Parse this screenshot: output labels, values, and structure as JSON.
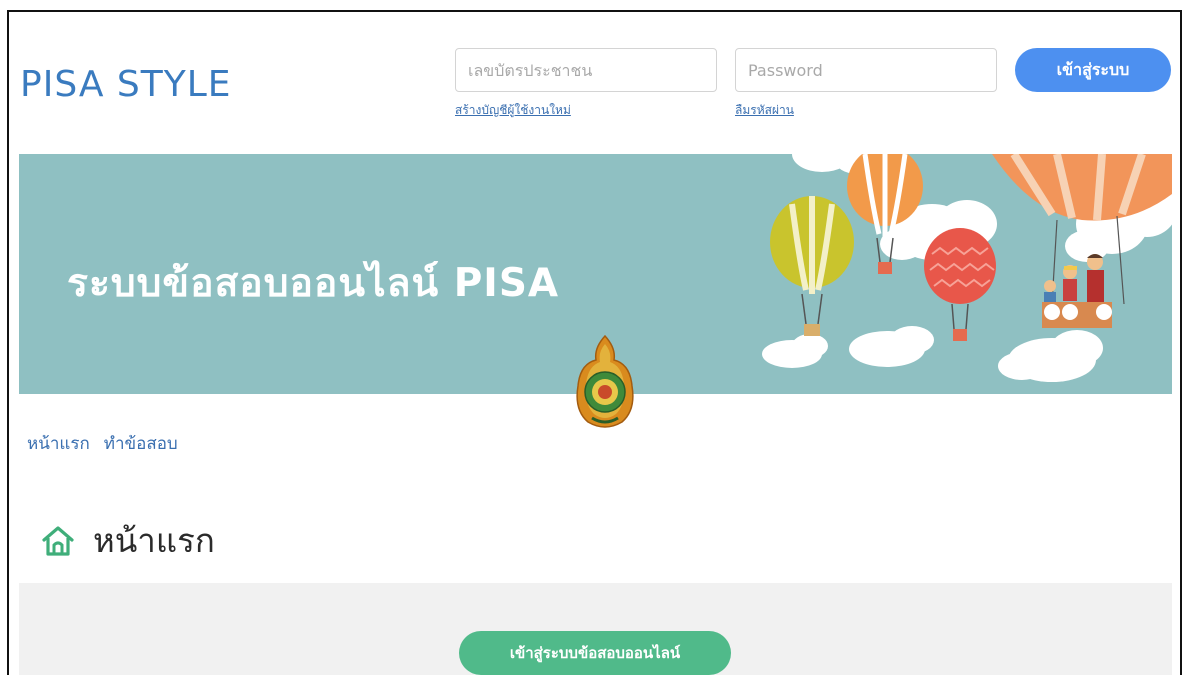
{
  "header": {
    "brand": "PISA STYLE",
    "id_field": {
      "placeholder": "เลขบัตรประชาชน",
      "value": ""
    },
    "password_field": {
      "placeholder": "Password",
      "value": ""
    },
    "register_link": "สร้างบัญชีผู้ใช้งานใหม่",
    "forgot_link": "ลืมรหัสผ่าน",
    "login_button": "เข้าสู่ระบบ"
  },
  "banner": {
    "title": "ระบบข้อสอบออนไลน์ PISA"
  },
  "nav": {
    "items": [
      {
        "label": "หน้าแรก"
      },
      {
        "label": "ทำข้อสอบ"
      }
    ]
  },
  "page": {
    "title": "หน้าแรก",
    "title_icon": "home-icon"
  },
  "panel": {
    "cta_button": "เข้าสู่ระบบข้อสอบออนไลน์"
  },
  "colors": {
    "brand": "#3a7bbf",
    "login_button": "#4d90f0",
    "banner_bg": "#8fc0c2",
    "cta_button": "#50ba8a",
    "panel_bg": "#f1f1f1",
    "home_icon": "#3fae7a"
  }
}
